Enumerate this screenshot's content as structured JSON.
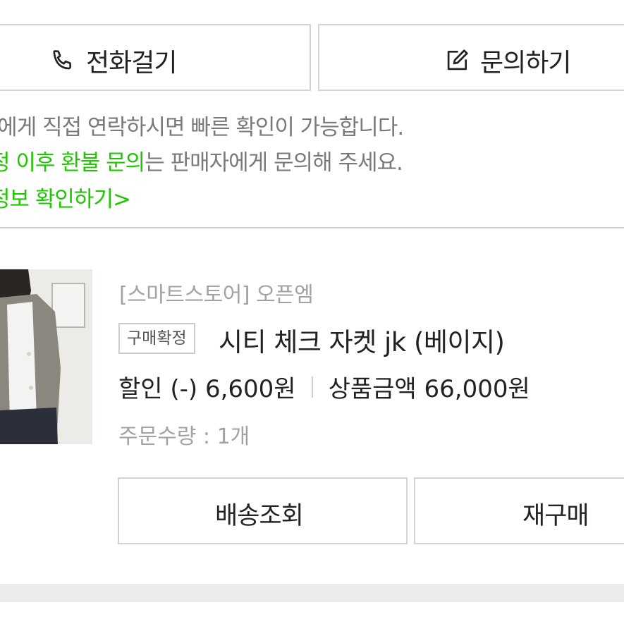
{
  "top_buttons": {
    "call_label": "전화걸기",
    "call_icon": "phone-icon",
    "inquiry_label": "문의하기",
    "inquiry_icon": "edit-icon"
  },
  "notice": {
    "line1": "-에게 직접 연락하시면 빠른 확인이 가능합니다.",
    "line2_highlight": "정 이후 환불 문의",
    "line2_rest": "는 판매자에게 문의해 주세요.",
    "line3_link": "정보 확인하기",
    "line3_arrow": ">",
    "highlight_color": "#1ec800"
  },
  "order": {
    "store": "[스마트스토어] 오픈엠",
    "status_badge": "구매확정",
    "product_title": "시티 체크 자켓 jk (베이지)",
    "discount": "할인 (-) 6,600원",
    "product_amount": "상품금액 66,000원",
    "quantity": "주문수량 : 1개"
  },
  "order_buttons": {
    "track_label": "배송조회",
    "reorder_label": "재구매"
  }
}
